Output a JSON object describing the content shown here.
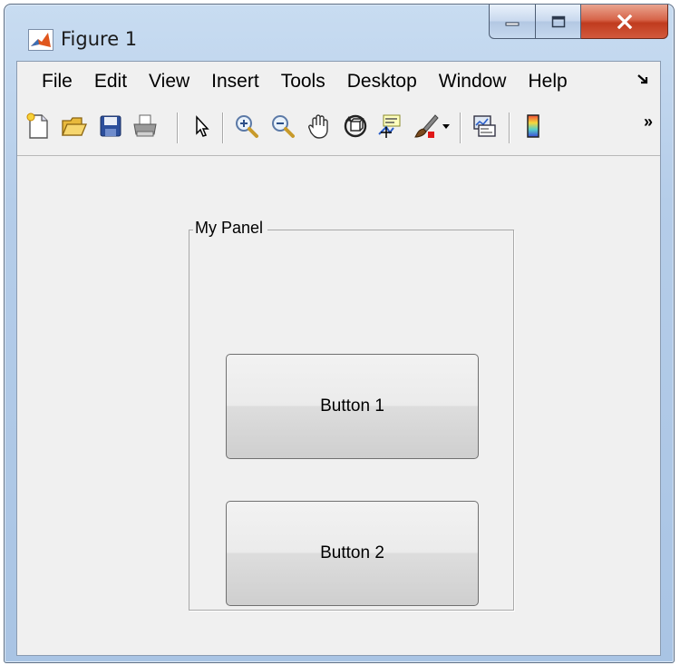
{
  "window": {
    "title": "Figure 1",
    "app_icon": "matlab-figure-icon"
  },
  "caption_buttons": {
    "minimize": "minimize-icon",
    "maximize": "maximize-icon",
    "close": "close-icon"
  },
  "menubar": {
    "items": [
      "File",
      "Edit",
      "View",
      "Insert",
      "Tools",
      "Desktop",
      "Window",
      "Help"
    ],
    "overflow_icon": "menu-overflow-icon"
  },
  "toolbar": {
    "items": [
      "new-figure-icon",
      "open-file-icon",
      "save-figure-icon",
      "print-figure-icon",
      "edit-plot-icon",
      "zoom-in-icon",
      "zoom-out-icon",
      "pan-icon",
      "rotate-3d-icon",
      "data-cursor-icon",
      "brush-icon",
      "brush-dropdown-icon",
      "link-plot-icon",
      "insert-colorbar-icon"
    ],
    "overflow_icon": "toolbar-overflow-icon"
  },
  "panel": {
    "title": "My Panel",
    "buttons": [
      {
        "label": "Button 1"
      },
      {
        "label": "Button 2"
      }
    ]
  }
}
